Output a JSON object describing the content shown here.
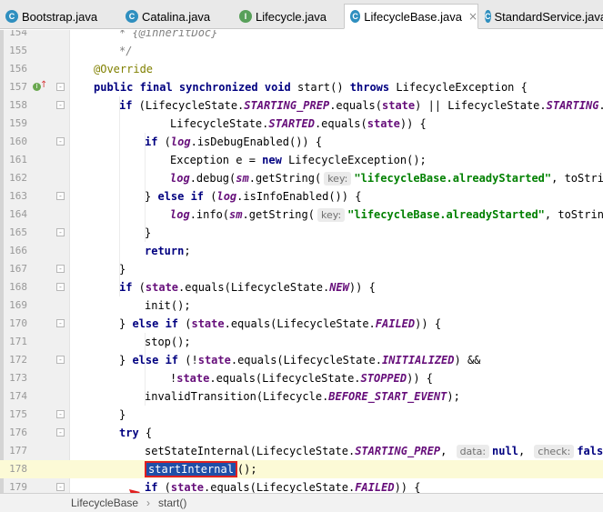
{
  "tabs": [
    {
      "name": "Bootstrap.java",
      "icon": "class-icon",
      "letter": "C",
      "active": false,
      "closable": false
    },
    {
      "name": "Catalina.java",
      "icon": "class-icon",
      "letter": "C",
      "active": false,
      "closable": false
    },
    {
      "name": "Lifecycle.java",
      "icon": "interface-icon",
      "letter": "I",
      "active": false,
      "closable": false
    },
    {
      "name": "LifecycleBase.java",
      "icon": "class-icon",
      "letter": "C",
      "active": true,
      "closable": true
    },
    {
      "name": "StandardService.java",
      "icon": "class-icon",
      "letter": "C",
      "active": false,
      "closable": false
    }
  ],
  "tab_close_glyph": "×",
  "code": {
    "lines": [
      {
        "num": "154",
        "indent": 1,
        "parts": [
          {
            "t": "* ",
            "c": "cmt"
          },
          {
            "t": "{@inheritDoc}",
            "c": "cmt"
          }
        ]
      },
      {
        "num": "155",
        "indent": 1,
        "parts": [
          {
            "t": "*/",
            "c": "cmt"
          }
        ]
      },
      {
        "num": "156",
        "indent": 0,
        "parts": [
          {
            "t": "@Override",
            "c": "ann"
          }
        ]
      },
      {
        "num": "157",
        "indent": 0,
        "fold": "-",
        "marker": true,
        "parts": [
          {
            "t": "public final synchronized void",
            "c": "kw"
          },
          {
            "t": " start() "
          },
          {
            "t": "throws",
            "c": "kw"
          },
          {
            "t": " LifecycleException {"
          }
        ]
      },
      {
        "num": "158",
        "indent": 1,
        "fold": "-",
        "parts": [
          {
            "t": "if",
            "c": "kw"
          },
          {
            "t": " (LifecycleState."
          },
          {
            "t": "STARTING_PREP",
            "c": "fld"
          },
          {
            "t": ".equals("
          },
          {
            "t": "state",
            "c": "ivar"
          },
          {
            "t": ") || LifecycleState."
          },
          {
            "t": "STARTING",
            "c": "fld"
          },
          {
            "t": ".eq"
          }
        ]
      },
      {
        "num": "159",
        "indent": 3,
        "parts": [
          {
            "t": "LifecycleState."
          },
          {
            "t": "STARTED",
            "c": "fld"
          },
          {
            "t": ".equals("
          },
          {
            "t": "state",
            "c": "ivar"
          },
          {
            "t": ")) {"
          }
        ]
      },
      {
        "num": "160",
        "indent": 2,
        "fold": "-",
        "parts": [
          {
            "t": "if",
            "c": "kw"
          },
          {
            "t": " ("
          },
          {
            "t": "log",
            "c": "fld"
          },
          {
            "t": ".isDebugEnabled()) {"
          }
        ]
      },
      {
        "num": "161",
        "indent": 3,
        "parts": [
          {
            "t": "Exception e = "
          },
          {
            "t": "new",
            "c": "kw"
          },
          {
            "t": " LifecycleException();"
          }
        ]
      },
      {
        "num": "162",
        "indent": 3,
        "parts": [
          {
            "t": "log",
            "c": "fld"
          },
          {
            "t": ".debug("
          },
          {
            "t": "sm",
            "c": "fld"
          },
          {
            "t": ".getString("
          },
          {
            "t": "key:",
            "c": "hint"
          },
          {
            "t": "\"lifecycleBase.alreadyStarted\"",
            "c": "str"
          },
          {
            "t": ", toString"
          }
        ]
      },
      {
        "num": "163",
        "indent": 2,
        "fold": "-",
        "parts": [
          {
            "t": "} "
          },
          {
            "t": "else if",
            "c": "kw"
          },
          {
            "t": " ("
          },
          {
            "t": "log",
            "c": "fld"
          },
          {
            "t": ".isInfoEnabled()) {"
          }
        ]
      },
      {
        "num": "164",
        "indent": 3,
        "parts": [
          {
            "t": "log",
            "c": "fld"
          },
          {
            "t": ".info("
          },
          {
            "t": "sm",
            "c": "fld"
          },
          {
            "t": ".getString("
          },
          {
            "t": "key:",
            "c": "hint"
          },
          {
            "t": "\"lifecycleBase.alreadyStarted\"",
            "c": "str"
          },
          {
            "t": ", toString("
          }
        ]
      },
      {
        "num": "165",
        "indent": 2,
        "fold": "-",
        "parts": [
          {
            "t": "}"
          }
        ]
      },
      {
        "num": "166",
        "indent": 2,
        "parts": [
          {
            "t": "return",
            "c": "kw"
          },
          {
            "t": ";"
          }
        ]
      },
      {
        "num": "167",
        "indent": 1,
        "fold": "-",
        "parts": [
          {
            "t": "}"
          }
        ]
      },
      {
        "num": "168",
        "indent": 1,
        "fold": "-",
        "parts": [
          {
            "t": "if",
            "c": "kw"
          },
          {
            "t": " ("
          },
          {
            "t": "state",
            "c": "ivar"
          },
          {
            "t": ".equals(LifecycleState."
          },
          {
            "t": "NEW",
            "c": "fld"
          },
          {
            "t": ")) {"
          }
        ]
      },
      {
        "num": "169",
        "indent": 2,
        "parts": [
          {
            "t": "init();"
          }
        ]
      },
      {
        "num": "170",
        "indent": 1,
        "fold": "-",
        "parts": [
          {
            "t": "} "
          },
          {
            "t": "else if",
            "c": "kw"
          },
          {
            "t": " ("
          },
          {
            "t": "state",
            "c": "ivar"
          },
          {
            "t": ".equals(LifecycleState."
          },
          {
            "t": "FAILED",
            "c": "fld"
          },
          {
            "t": ")) {"
          }
        ]
      },
      {
        "num": "171",
        "indent": 2,
        "parts": [
          {
            "t": "stop();"
          }
        ]
      },
      {
        "num": "172",
        "indent": 1,
        "fold": "-",
        "parts": [
          {
            "t": "} "
          },
          {
            "t": "else if",
            "c": "kw"
          },
          {
            "t": " (!"
          },
          {
            "t": "state",
            "c": "ivar"
          },
          {
            "t": ".equals(LifecycleState."
          },
          {
            "t": "INITIALIZED",
            "c": "fld"
          },
          {
            "t": ") &&"
          }
        ]
      },
      {
        "num": "173",
        "indent": 3,
        "parts": [
          {
            "t": "!"
          },
          {
            "t": "state",
            "c": "ivar"
          },
          {
            "t": ".equals(LifecycleState."
          },
          {
            "t": "STOPPED",
            "c": "fld"
          },
          {
            "t": ")) {"
          }
        ]
      },
      {
        "num": "174",
        "indent": 2,
        "parts": [
          {
            "t": "invalidTransition(Lifecycle."
          },
          {
            "t": "BEFORE_START_EVENT",
            "c": "fld"
          },
          {
            "t": ");"
          }
        ]
      },
      {
        "num": "175",
        "indent": 1,
        "fold": "-",
        "parts": [
          {
            "t": "}"
          }
        ]
      },
      {
        "num": "176",
        "indent": 1,
        "fold": "-",
        "parts": [
          {
            "t": "try",
            "c": "kw"
          },
          {
            "t": " {"
          }
        ]
      },
      {
        "num": "177",
        "indent": 2,
        "parts": [
          {
            "t": "setStateInternal(LifecycleState."
          },
          {
            "t": "STARTING_PREP",
            "c": "fld"
          },
          {
            "t": ", "
          },
          {
            "t": "data:",
            "c": "hint"
          },
          {
            "t": "null",
            "c": "kw"
          },
          {
            "t": ", "
          },
          {
            "t": "check:",
            "c": "hint"
          },
          {
            "t": "false",
            "c": "kw"
          },
          {
            "t": ")"
          }
        ]
      },
      {
        "num": "178",
        "indent": 2,
        "highlight": true,
        "parts": [
          {
            "t": "startInternal",
            "c": "sel"
          },
          {
            "t": "();"
          }
        ]
      },
      {
        "num": "179",
        "indent": 2,
        "fold": "-",
        "parts": [
          {
            "t": "if",
            "c": "kw"
          },
          {
            "t": " ("
          },
          {
            "t": "state",
            "c": "ivar"
          },
          {
            "t": ".equals(LifecycleState."
          },
          {
            "t": "FAILED",
            "c": "fld"
          },
          {
            "t": ")) {"
          }
        ]
      }
    ]
  },
  "breadcrumb": {
    "items": [
      "LifecycleBase",
      "start()"
    ],
    "separator": "›"
  },
  "colors": {
    "keyword": "#000080",
    "field": "#660e7a",
    "string": "#008000",
    "annotation": "#808000",
    "line_highlight": "#fcfad6",
    "selection_border": "#e02020",
    "arrow": "#e02020"
  }
}
